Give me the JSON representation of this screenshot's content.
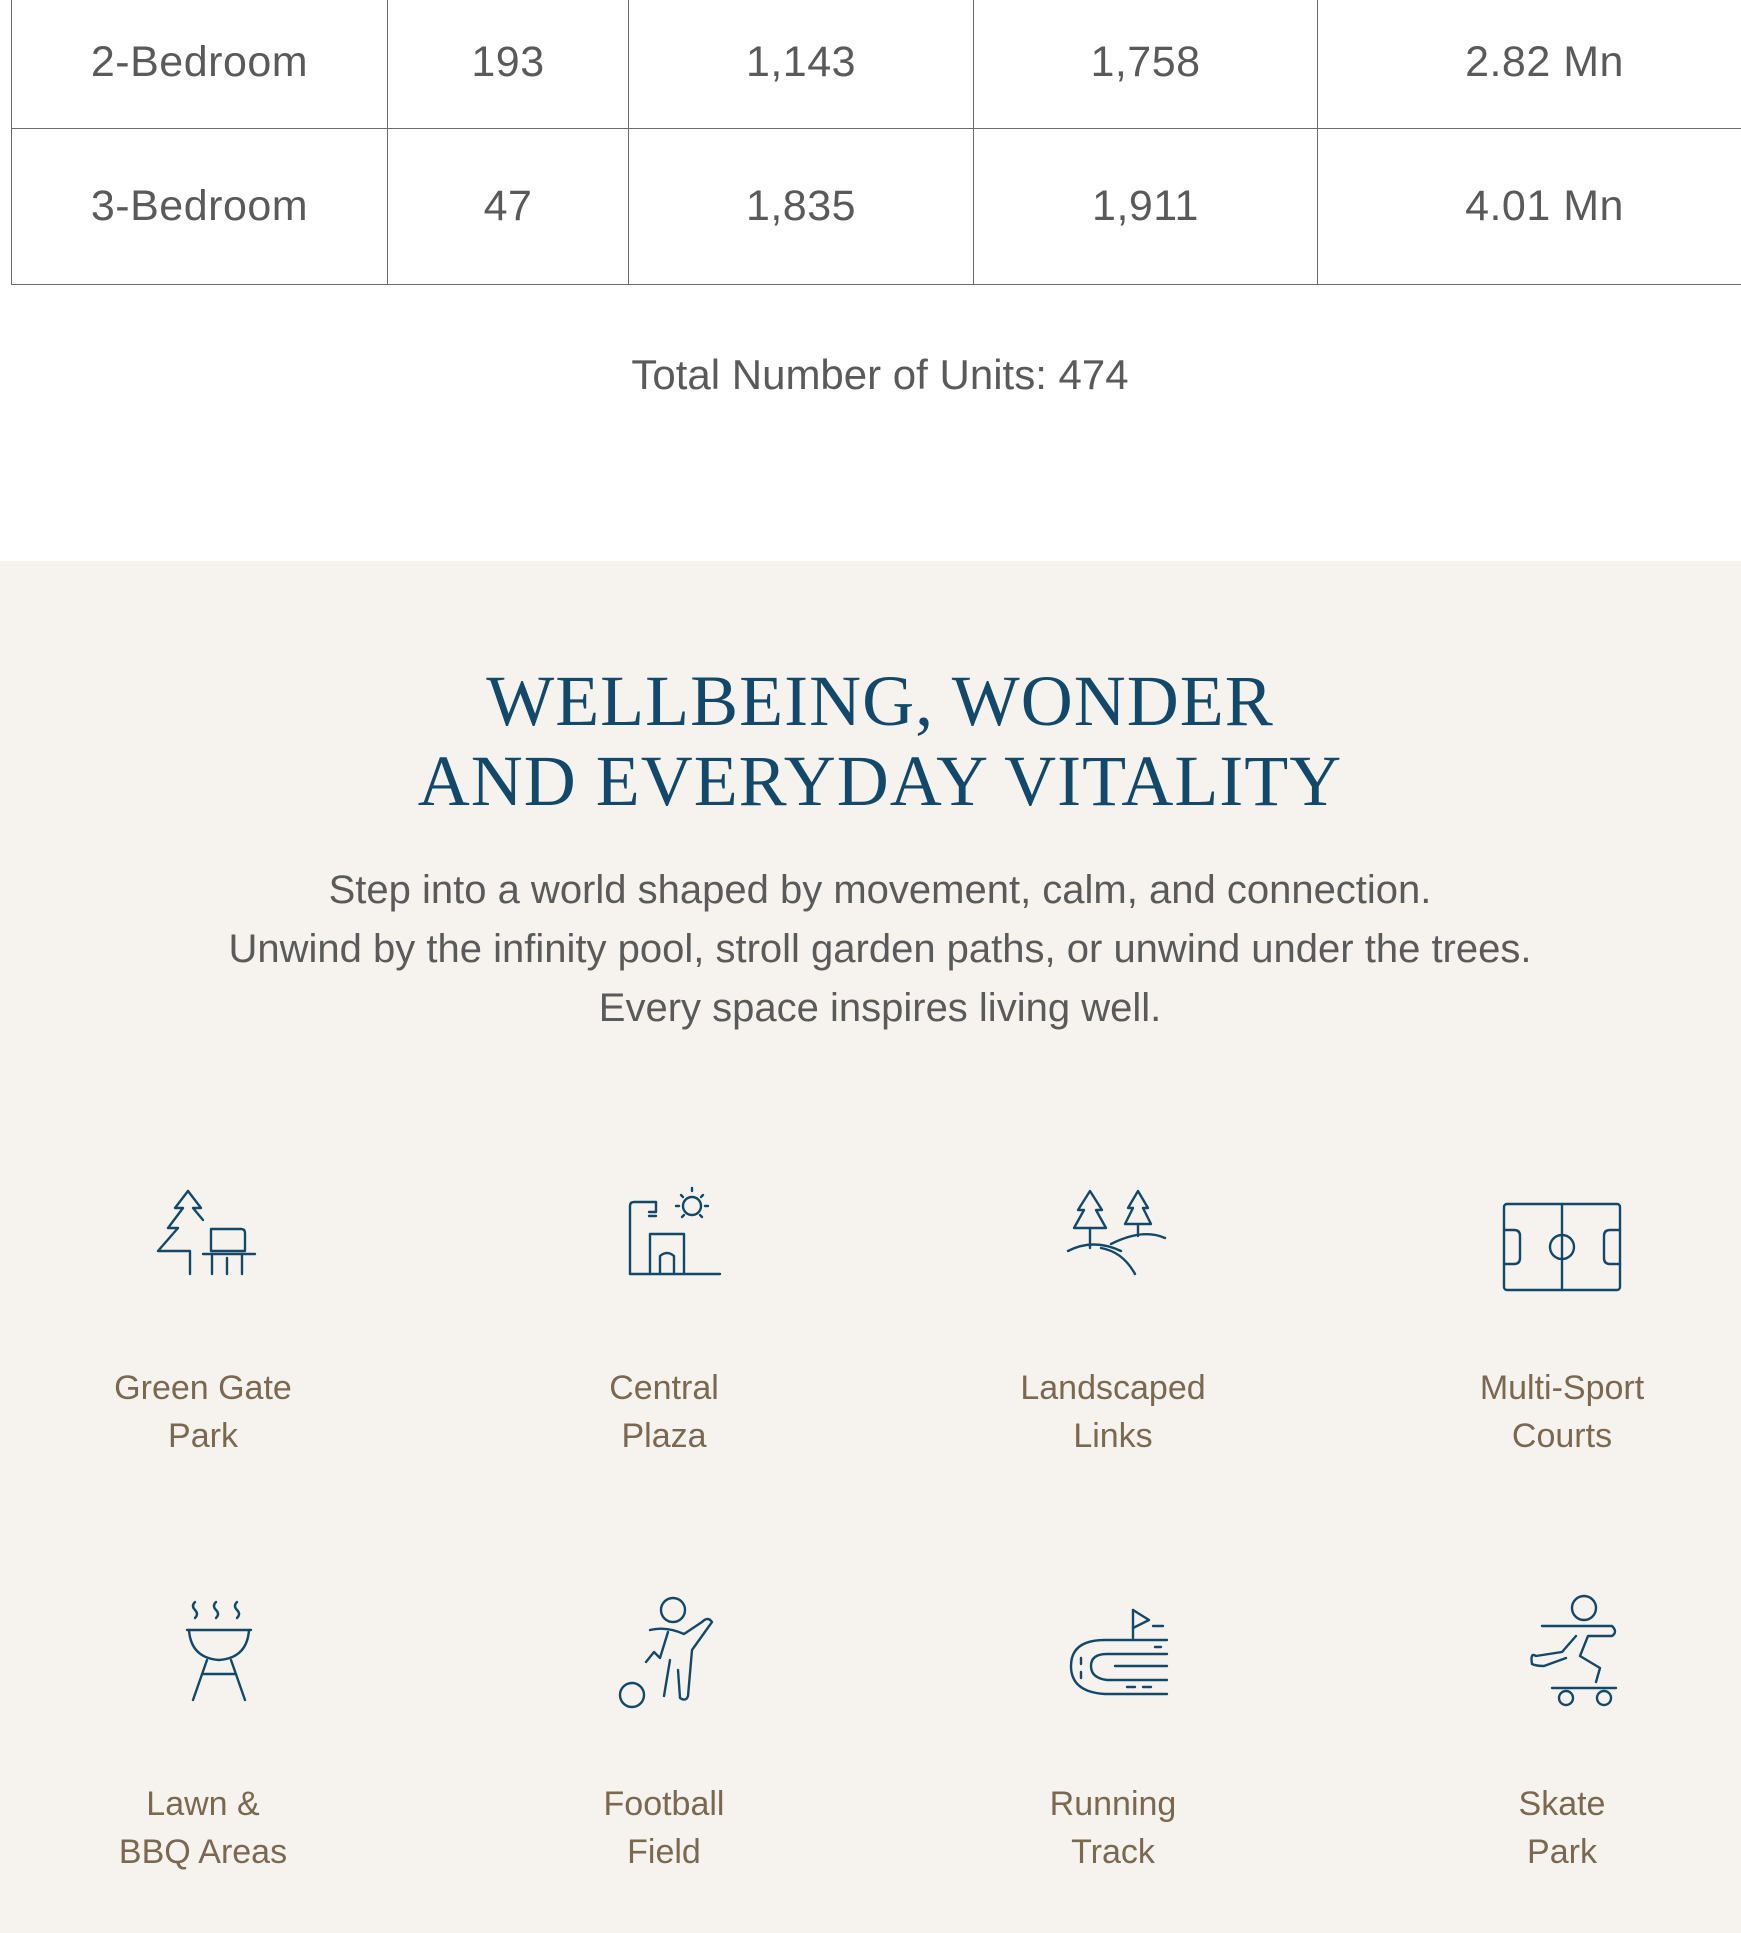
{
  "unit_table": {
    "rows": [
      {
        "type": "2-Bedroom",
        "count": "193",
        "min": "1,143",
        "max": "1,758",
        "price": "2.82 Mn"
      },
      {
        "type": "3-Bedroom",
        "count": "47",
        "min": "1,835",
        "max": "1,911",
        "price": "4.01 Mn"
      }
    ],
    "total_units": "Total Number of Units: 474"
  },
  "amenities_section": {
    "background_color": "#f6f3ee",
    "accent_color": "#12496b",
    "title_lines": [
      "WELLBEING, WONDER",
      "AND EVERYDAY VITALITY"
    ],
    "intro_lines": [
      "Step into a world shaped by movement, calm, and connection.",
      "Unwind by the infinity pool, stroll garden paths, or unwind under the trees.",
      "Every space inspires living well."
    ],
    "items": [
      {
        "icon": "park-bench-icon",
        "label_lines": [
          "Green Gate",
          "Park"
        ]
      },
      {
        "icon": "plaza-icon",
        "label_lines": [
          "Central",
          "Plaza"
        ]
      },
      {
        "icon": "landscape-trees-icon",
        "label_lines": [
          "Landscaped",
          "Links"
        ]
      },
      {
        "icon": "sport-court-icon",
        "label_lines": [
          "Multi-Sport",
          "Courts"
        ]
      },
      {
        "icon": "bbq-grill-icon",
        "label_lines": [
          "Lawn &",
          "BBQ Areas"
        ]
      },
      {
        "icon": "football-player-icon",
        "label_lines": [
          "Football",
          "Field"
        ]
      },
      {
        "icon": "running-track-icon",
        "label_lines": [
          "Running",
          "Track"
        ]
      },
      {
        "icon": "skateboarder-icon",
        "label_lines": [
          "Skate",
          "Park"
        ]
      }
    ]
  }
}
